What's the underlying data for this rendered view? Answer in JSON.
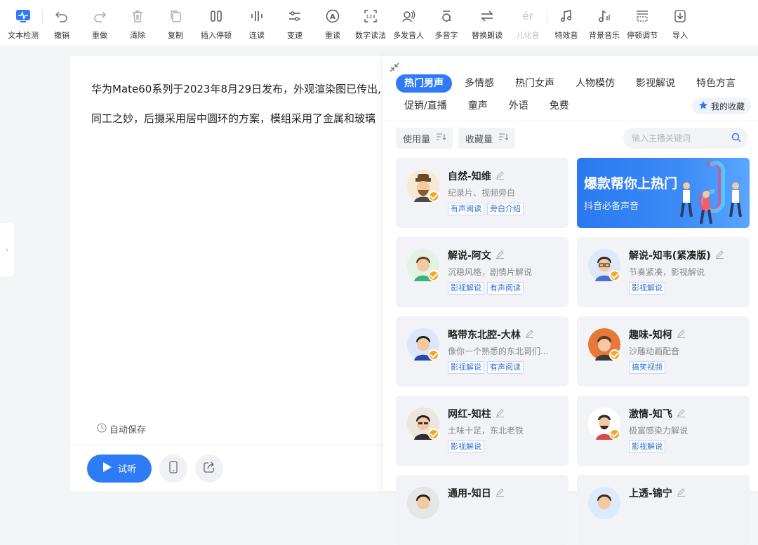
{
  "toolbar": {
    "items": [
      {
        "label": "文本检测",
        "icon": "text-check-icon"
      },
      {
        "label": "撤销",
        "icon": "undo-icon"
      },
      {
        "label": "重做",
        "icon": "redo-icon"
      },
      {
        "label": "清除",
        "icon": "trash-icon"
      },
      {
        "label": "复制",
        "icon": "copy-icon"
      },
      {
        "label": "插入停顿",
        "icon": "pause-insert-icon"
      },
      {
        "label": "连读",
        "icon": "link-read-icon"
      },
      {
        "label": "变速",
        "icon": "speed-icon"
      },
      {
        "label": "重读",
        "icon": "stress-icon"
      },
      {
        "label": "数字读法",
        "icon": "number-read-icon"
      },
      {
        "label": "多发音人",
        "icon": "multi-speaker-icon"
      },
      {
        "label": "多音字",
        "icon": "polyphone-icon"
      },
      {
        "label": "替换朗读",
        "icon": "replace-read-icon"
      },
      {
        "label": "儿化音",
        "icon": "erhua-icon"
      },
      {
        "label": "特效音",
        "icon": "music-note-icon"
      },
      {
        "label": "背景音乐",
        "icon": "bg-music-icon"
      },
      {
        "label": "停顿调节",
        "icon": "pause-adjust-icon"
      },
      {
        "label": "导入",
        "icon": "import-icon"
      }
    ]
  },
  "editor": {
    "line1": "华为Mate60系列于2023年8月29日发布，外观渲染图已传出,",
    "line2": "同工之妙，后摄采用居中圆环的方案，模组采用了金属和玻璃",
    "autosave": "自动保存",
    "listen_label": "试听"
  },
  "panel": {
    "tabs_row1": [
      "热门男声",
      "多情感",
      "热门女声",
      "人物模仿",
      "影视解说",
      "特色方言"
    ],
    "tabs_row2": [
      "促销/直播",
      "童声",
      "外语",
      "免费"
    ],
    "favorites_label": "我的收藏",
    "sort": [
      "使用量",
      "收藏量"
    ],
    "search_placeholder": "输入主播关键词",
    "banner": {
      "title": "爆款帮你上热门",
      "subtitle": "抖音必备声音"
    },
    "voices": [
      {
        "name": "自然-知维",
        "desc": "纪录片、视频旁白",
        "tags": [
          "有声阅读",
          "旁白介绍"
        ]
      },
      {
        "name": "解说-阿文",
        "desc": "沉稳风格，剧情片解说",
        "tags": [
          "影视解说",
          "有声阅读"
        ]
      },
      {
        "name": "解说-知韦(紧凑版)",
        "desc": "节奏紧凑，影视解说",
        "tags": [
          "影视解说"
        ]
      },
      {
        "name": "略带东北腔-大林",
        "desc": "像你一个熟悉的东北哥们...",
        "tags": [
          "影视解说",
          "有声阅读"
        ]
      },
      {
        "name": "趣味-知柯",
        "desc": "沙雕动画配音",
        "tags": [
          "搞笑视频"
        ]
      },
      {
        "name": "网红-知柱",
        "desc": "土味十足，东北老铁",
        "tags": [
          "影视解说"
        ]
      },
      {
        "name": "激情-知飞",
        "desc": "极富感染力解说",
        "tags": [
          "影视解说"
        ]
      },
      {
        "name": "通用-知日",
        "desc": "",
        "tags": []
      },
      {
        "name": "上透-锦宁",
        "desc": "",
        "tags": []
      }
    ]
  }
}
